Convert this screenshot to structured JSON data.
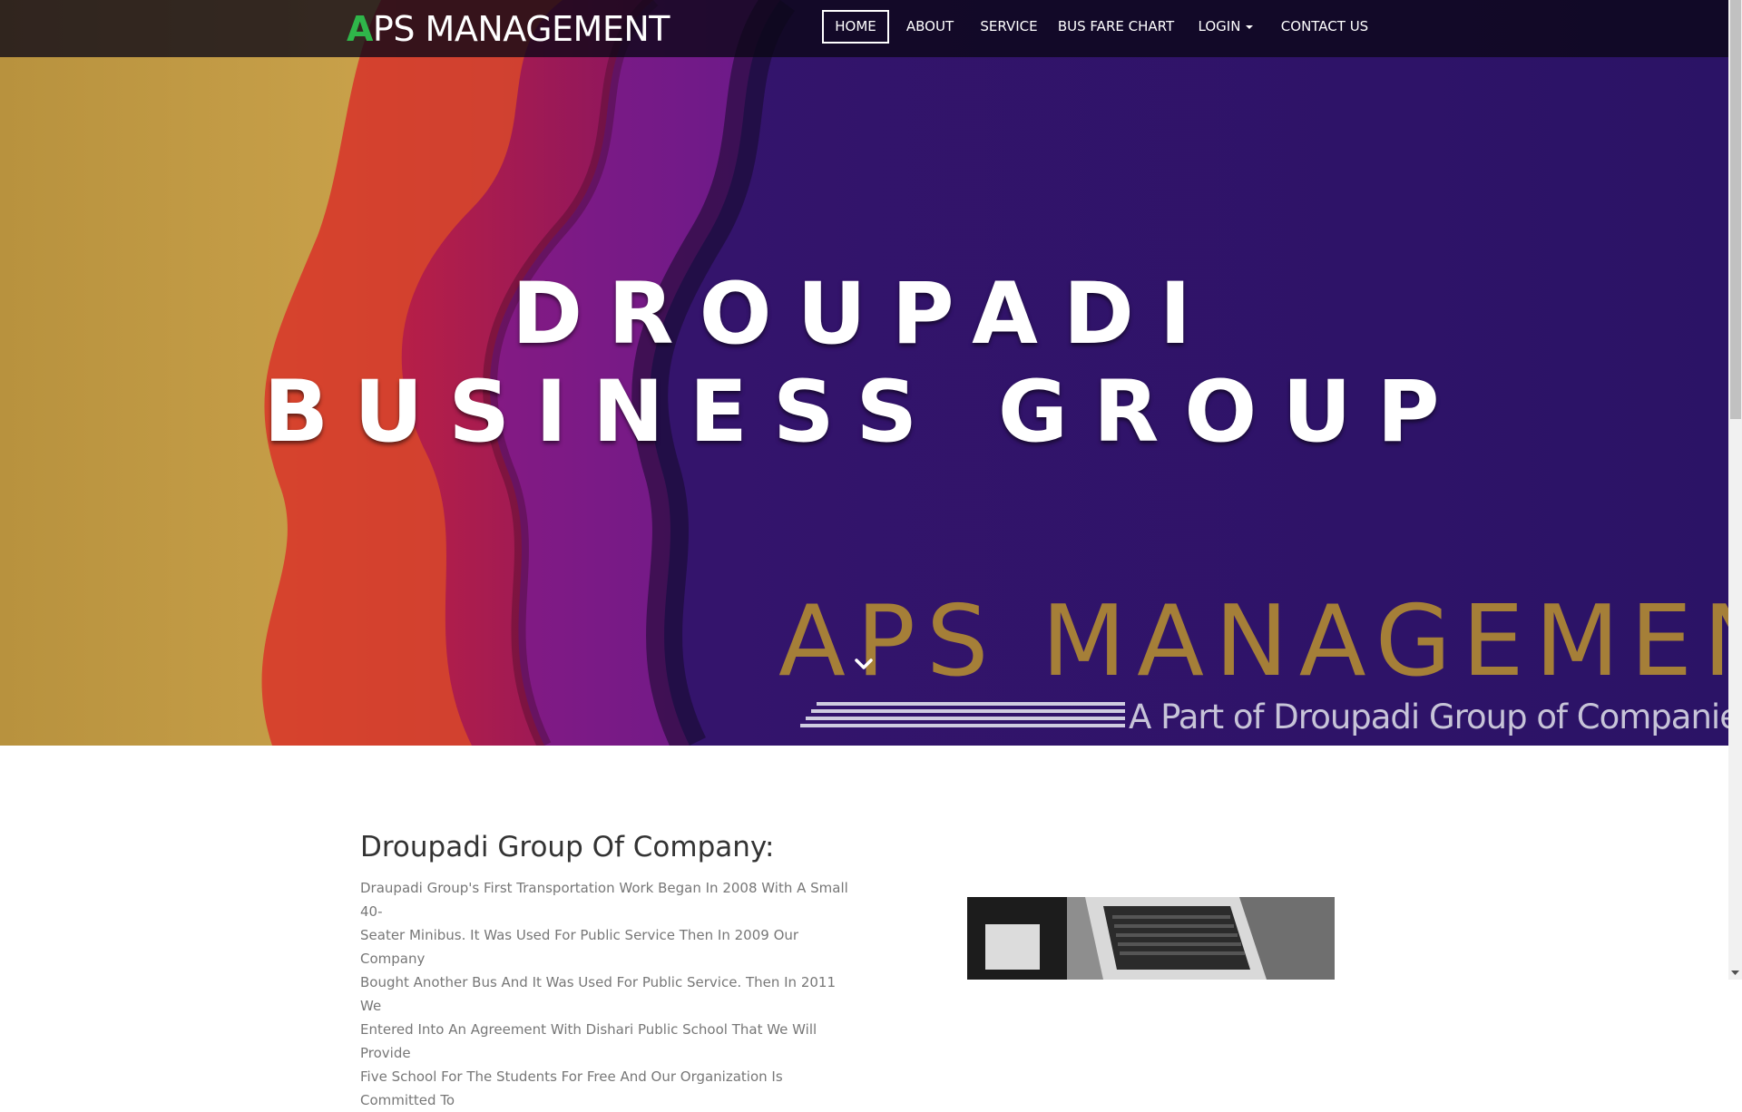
{
  "navbar": {
    "brand_first_letter": "A",
    "brand_rest": "PS MANAGEMENT",
    "items": [
      {
        "label": "HOME",
        "active": true
      },
      {
        "label": "ABOUT",
        "active": false
      },
      {
        "label": "SERVICE",
        "active": false
      },
      {
        "label": "BUS FARE CHART",
        "active": false
      },
      {
        "label": "LOGIN",
        "active": false,
        "dropdown": true
      },
      {
        "label": "CONTACT US",
        "active": false
      }
    ]
  },
  "hero": {
    "title_line1": "DROUPADI",
    "title_line2": "BUSINESS GROUP",
    "banner_brand": "APS MANAGEMENT",
    "banner_tagline": "A Part of Droupadi Group of Companies",
    "scroll_icon": "chevron-down-icon"
  },
  "about": {
    "heading": "Droupadi Group Of Company:",
    "text": "Draupadi Group's First Transportation Work Began In 2008 With A Small 40-\nSeater Minibus. It Was Used For Public Service Then In 2009 Our Company\nBought Another Bus And It Was Used For Public Service. Then In 2011 We\nEntered Into An Agreement With Dishari Public School That We Will Provide\nFive School For The Students For Free And Our Organization Is Committed To"
  },
  "colors": {
    "brand_accent": "#2fb64a",
    "banner_gold": "#a57f38",
    "hero_purple": "#2a1363",
    "navbar_bg": "#0a0616"
  }
}
